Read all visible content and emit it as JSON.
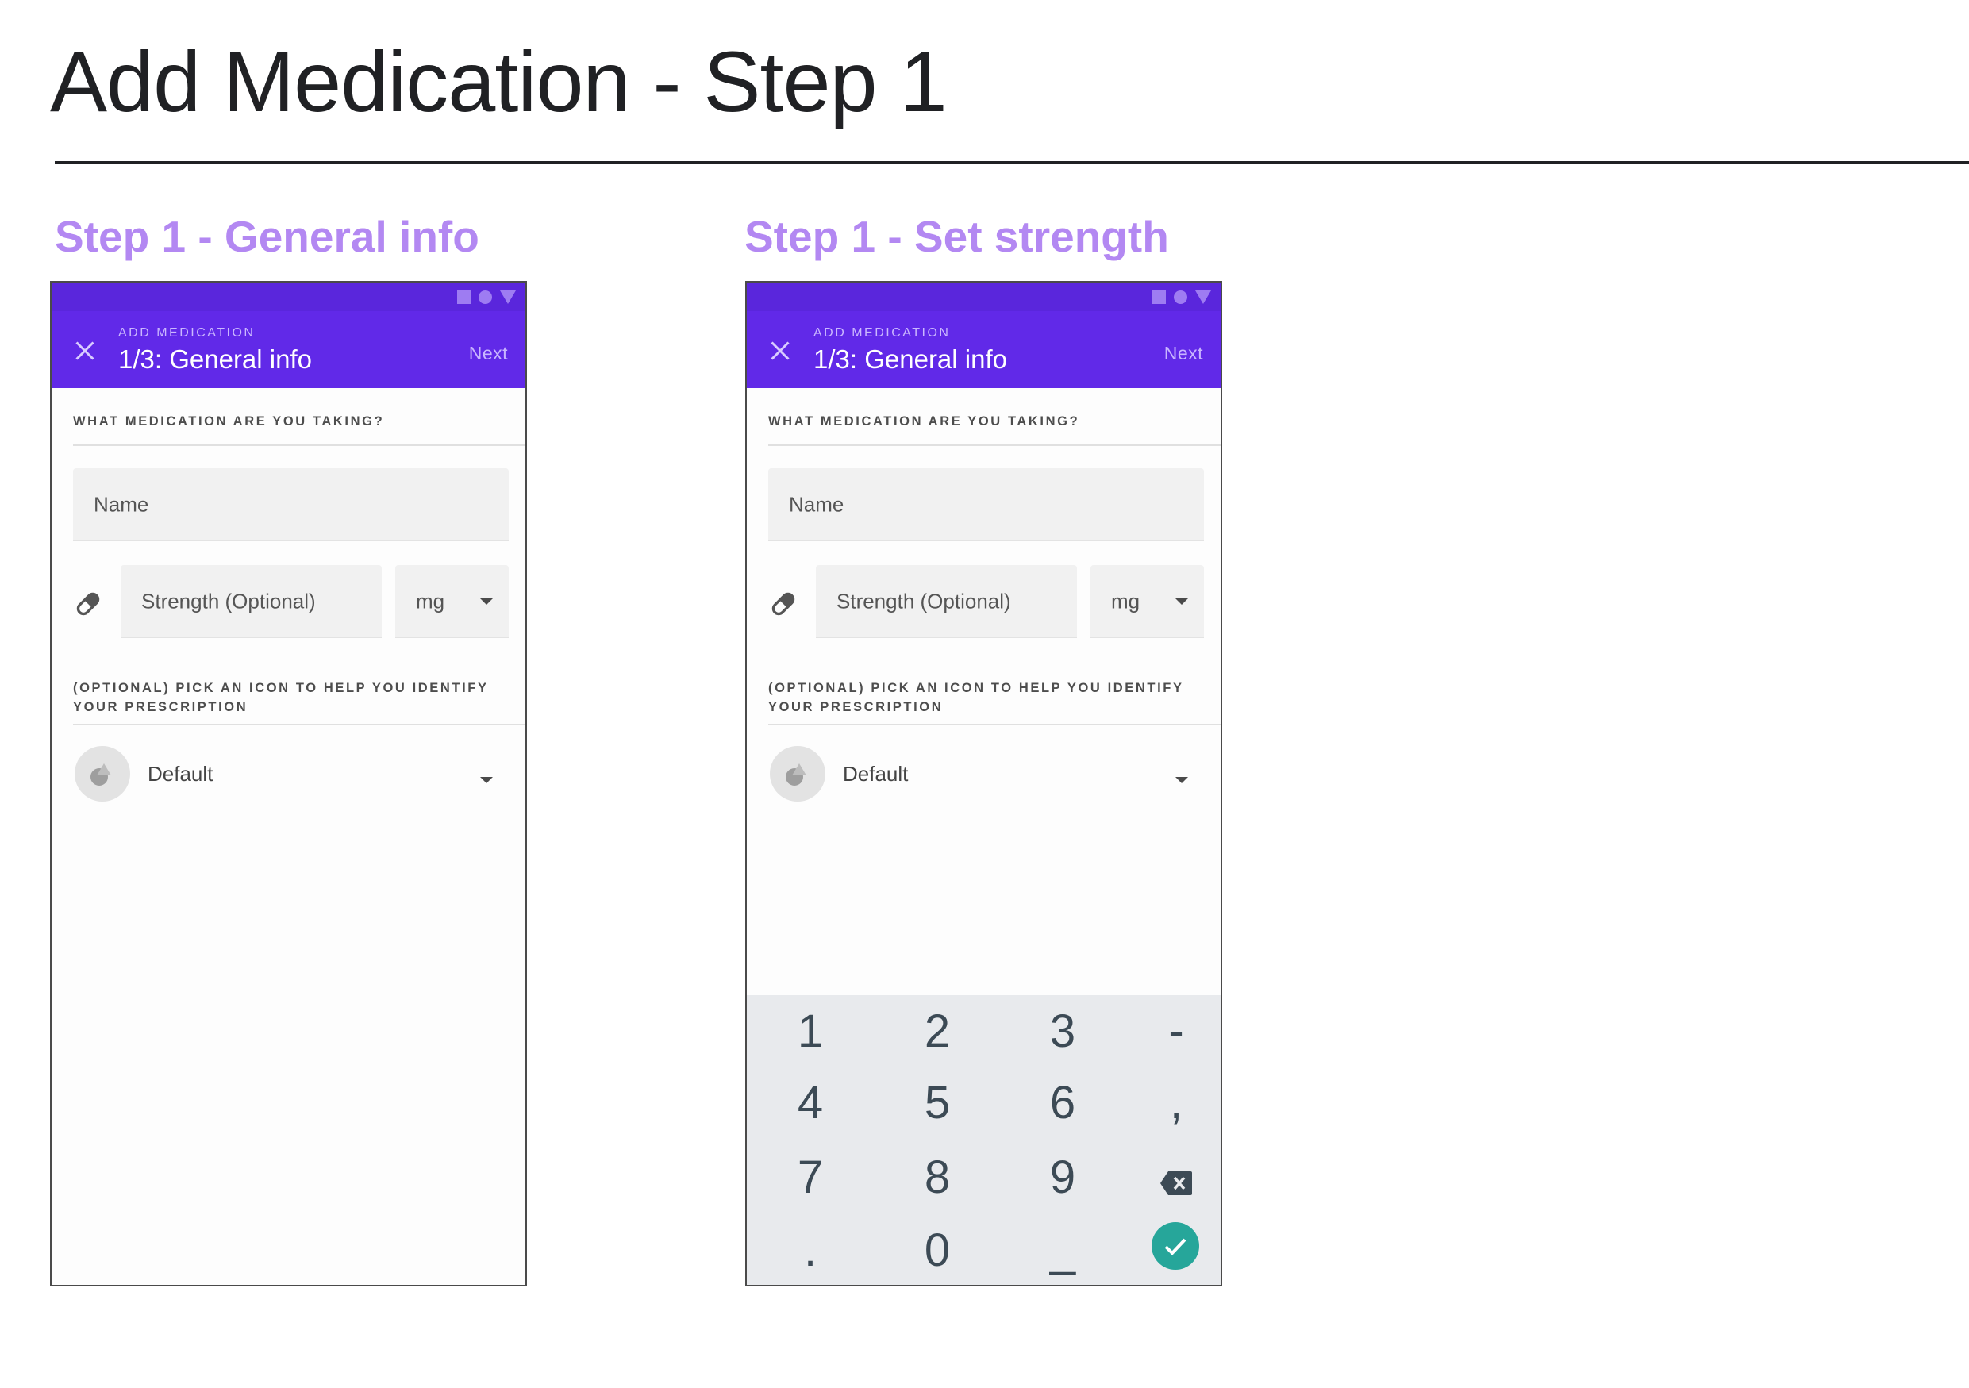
{
  "page": {
    "title": "Add Medication - Step 1"
  },
  "screens": [
    {
      "section_label": "Step 1 - General info",
      "appbar": {
        "overline": "ADD MEDICATION",
        "title": "1/3: General info",
        "next": "Next",
        "close_icon": "close-icon"
      },
      "question": "WHAT MEDICATION ARE YOU TAKING?",
      "name_placeholder": "Name",
      "strength_placeholder": "Strength (Optional)",
      "unit_value": "mg",
      "icon_caption": "(OPTIONAL) PICK AN ICON TO HELP YOU IDENTIFY YOUR PRESCRIPTION",
      "icon_default": "Default"
    },
    {
      "section_label": "Step 1 - Set strength",
      "appbar": {
        "overline": "ADD MEDICATION",
        "title": "1/3: General info",
        "next": "Next",
        "close_icon": "close-icon"
      },
      "question": "WHAT MEDICATION ARE YOU TAKING?",
      "name_placeholder": "Name",
      "strength_placeholder": "Strength (Optional)",
      "unit_value": "mg",
      "icon_caption": "(OPTIONAL) PICK AN ICON TO HELP YOU IDENTIFY YOUR PRESCRIPTION",
      "icon_default": "Default",
      "keypad": {
        "keys": [
          "1",
          "2",
          "3",
          "-",
          "4",
          "5",
          "6",
          ",",
          "7",
          "8",
          "9",
          "⌫",
          ".",
          "0",
          "_",
          "✓"
        ],
        "backspace_icon": "backspace-icon",
        "done_icon": "check-icon",
        "done_color": "#26a69a"
      }
    }
  ],
  "colors": {
    "appbar": "#6129e8",
    "section_label": "#b388f2"
  }
}
